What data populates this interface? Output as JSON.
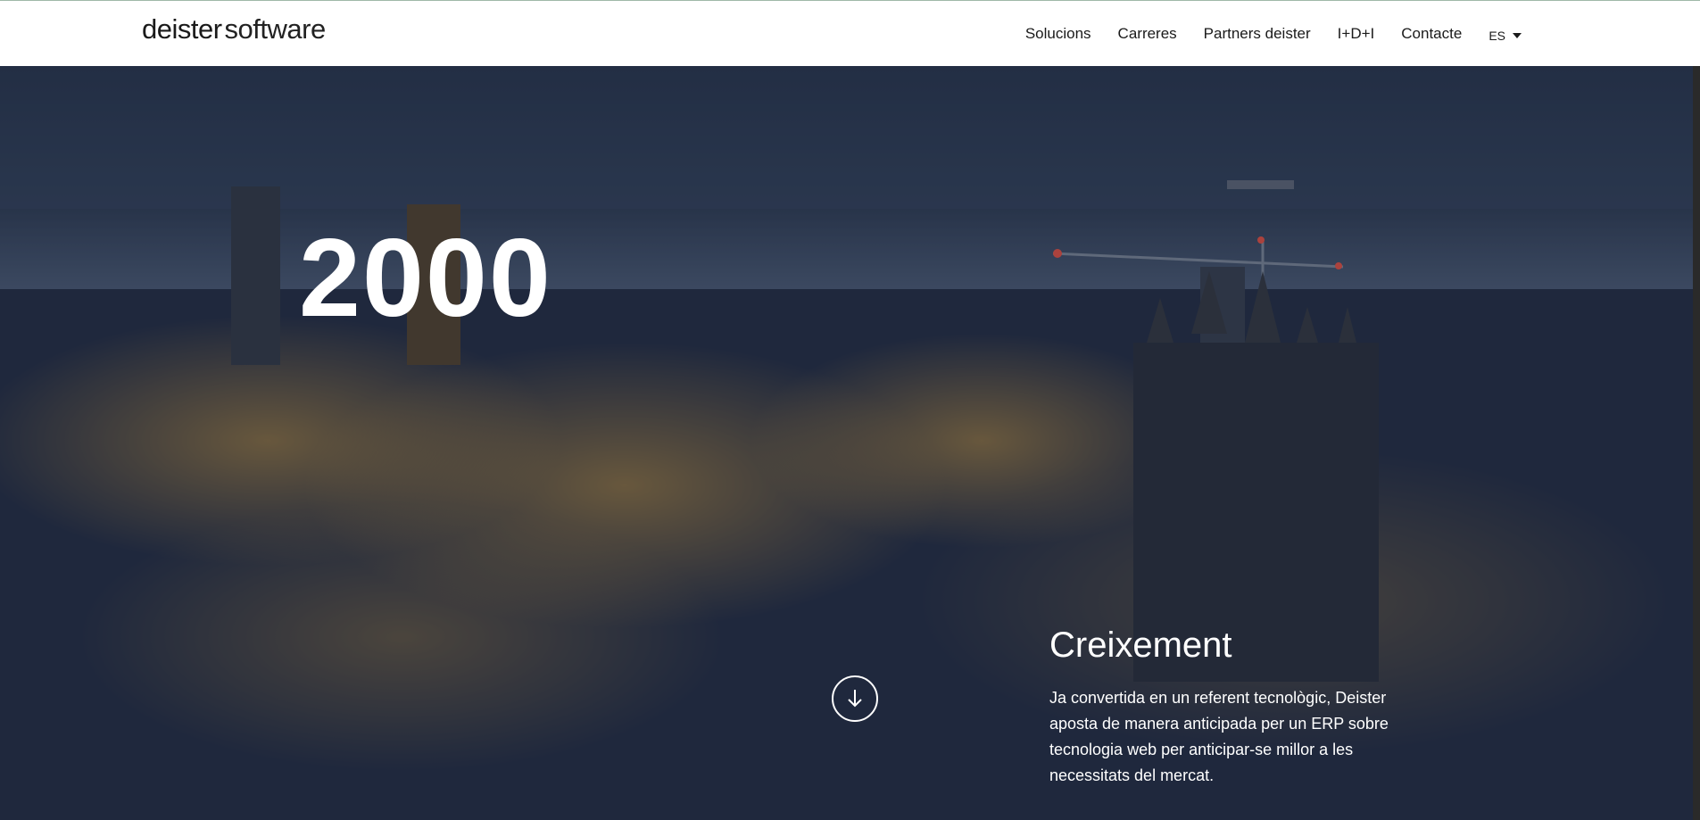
{
  "header": {
    "logo_brand": "deister",
    "logo_suffix": "software",
    "nav": [
      {
        "label": "Solucions"
      },
      {
        "label": "Carreres"
      },
      {
        "label": "Partners deister"
      },
      {
        "label": "I+D+I"
      },
      {
        "label": "Contacte"
      }
    ],
    "language": "ES"
  },
  "hero": {
    "year": "2000",
    "title": "Creixement",
    "body": "Ja convertida en un referent tecnològic, Deister aposta de manera anticipada per un ERP sobre tecnologia web per anticipar-se millor a les necessitats del mercat.",
    "scroll_icon": "arrow-down-icon"
  },
  "colors": {
    "header_bg": "#ffffff",
    "hero_overlay": "#1f2a3d",
    "city_lights": "#e8a63a"
  }
}
